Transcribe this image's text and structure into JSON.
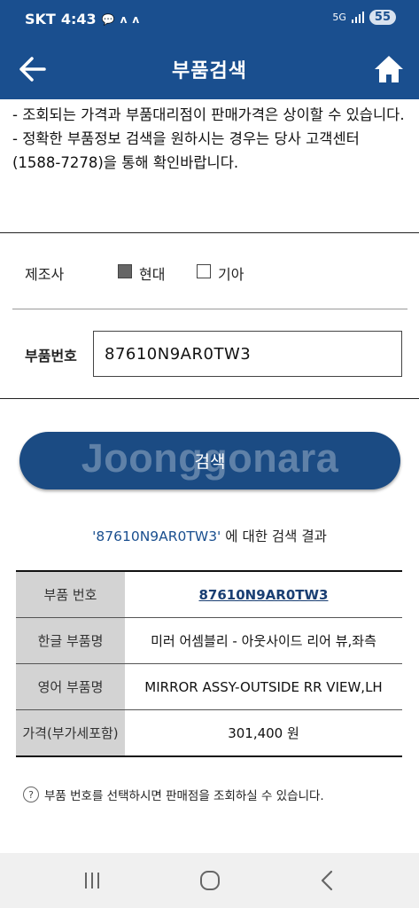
{
  "status": {
    "carrier": "SKT",
    "time": "4:43",
    "battery": "55",
    "network": "5G"
  },
  "header": {
    "title": "부품검색"
  },
  "notice": [
    "- 조회되는 가격과 부품대리점이 판매가격은 상이할 수 있습니다.",
    "- 정확한 부품정보 검색을 원하시는 경우는 당사 고객센터 (1588-7278)을 통해 확인바랍니다."
  ],
  "form": {
    "maker_label": "제조사",
    "options": [
      {
        "label": "현대",
        "checked": true
      },
      {
        "label": "기아",
        "checked": false
      }
    ],
    "part_label": "부품번호",
    "part_value": "87610N9AR0TW3",
    "search_label": "검색"
  },
  "watermark": "Joonggonara",
  "result": {
    "query": "'87610N9AR0TW3'",
    "suffix": " 에 대한 검색 결과",
    "rows": [
      {
        "header": "부품 번호",
        "value": "87610N9AR0TW3"
      },
      {
        "header": "한글 부품명",
        "value": "미러 어셈블리 - 아웃사이드 리어 뷰,좌측"
      },
      {
        "header": "영어 부품명",
        "value": "MIRROR ASSY-OUTSIDE RR VIEW,LH"
      },
      {
        "header": "가격(부가세포함)",
        "value": "301,400 원"
      }
    ]
  },
  "footnote": "부품 번호를 선택하시면 판매점을 조회하실 수 있습니다.",
  "colors": {
    "primary": "#1a4f8f",
    "button": "#1b4b83",
    "table_header": "#d3d3d3"
  }
}
